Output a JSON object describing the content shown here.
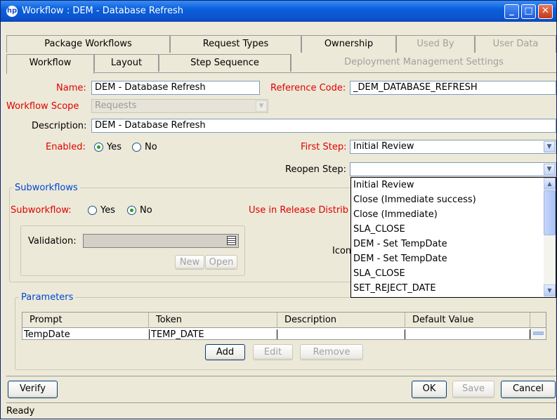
{
  "window": {
    "title": "Workflow : DEM - Database Refresh"
  },
  "tabs_row1": [
    {
      "label": "Package Workflows",
      "disabled": false
    },
    {
      "label": "Request Types",
      "disabled": false
    },
    {
      "label": "Ownership",
      "disabled": false
    },
    {
      "label": "Used By",
      "disabled": true
    },
    {
      "label": "User Data",
      "disabled": true
    }
  ],
  "tabs_row2": [
    {
      "label": "Workflow",
      "active": true
    },
    {
      "label": "Layout"
    },
    {
      "label": "Step Sequence"
    },
    {
      "label": "Deployment Management Settings",
      "disabled": true
    }
  ],
  "form": {
    "name_label": "Name:",
    "name_value": "DEM - Database Refresh",
    "refcode_label": "Reference Code:",
    "refcode_value": "_DEM_DATABASE_REFRESH",
    "scope_label": "Workflow Scope",
    "scope_value": "Requests",
    "description_label": "Description:",
    "description_value": "DEM - Database Refresh",
    "enabled_label": "Enabled:",
    "enabled_yes": "Yes",
    "enabled_no": "No",
    "first_step_label": "First Step:",
    "first_step_value": "Initial Review",
    "reopen_step_label": "Reopen Step:",
    "reopen_step_value": ""
  },
  "subworkflows": {
    "title": "Subworkflows",
    "subworkflow_label": "Subworkflow:",
    "yes": "Yes",
    "no": "No",
    "release_label": "Use in Release Distrib",
    "validation_label": "Validation:",
    "new_button": "New",
    "open_button": "Open",
    "icon_label": "Icon"
  },
  "reopen_dropdown": {
    "options": [
      "Initial Review",
      "Close (Immediate success)",
      "Close (Immediate)",
      "SLA_CLOSE",
      "DEM - Set TempDate",
      "DEM - Set TempDate",
      "SLA_CLOSE",
      "SET_REJECT_DATE"
    ]
  },
  "parameters": {
    "title": "Parameters",
    "columns": [
      "Prompt",
      "Token",
      "Description",
      "Default Value"
    ],
    "rows": [
      {
        "prompt": "TempDate",
        "token": "TEMP_DATE",
        "description": "",
        "default": ""
      }
    ],
    "add_button": "Add",
    "edit_button": "Edit",
    "remove_button": "Remove"
  },
  "footer": {
    "verify_button": "Verify",
    "ok_button": "OK",
    "save_button": "Save",
    "cancel_button": "Cancel",
    "status": "Ready"
  },
  "icons": {
    "app": "hp-logo-icon",
    "minimize": "minimize-icon",
    "maximize": "maximize-icon",
    "close": "close-icon"
  }
}
